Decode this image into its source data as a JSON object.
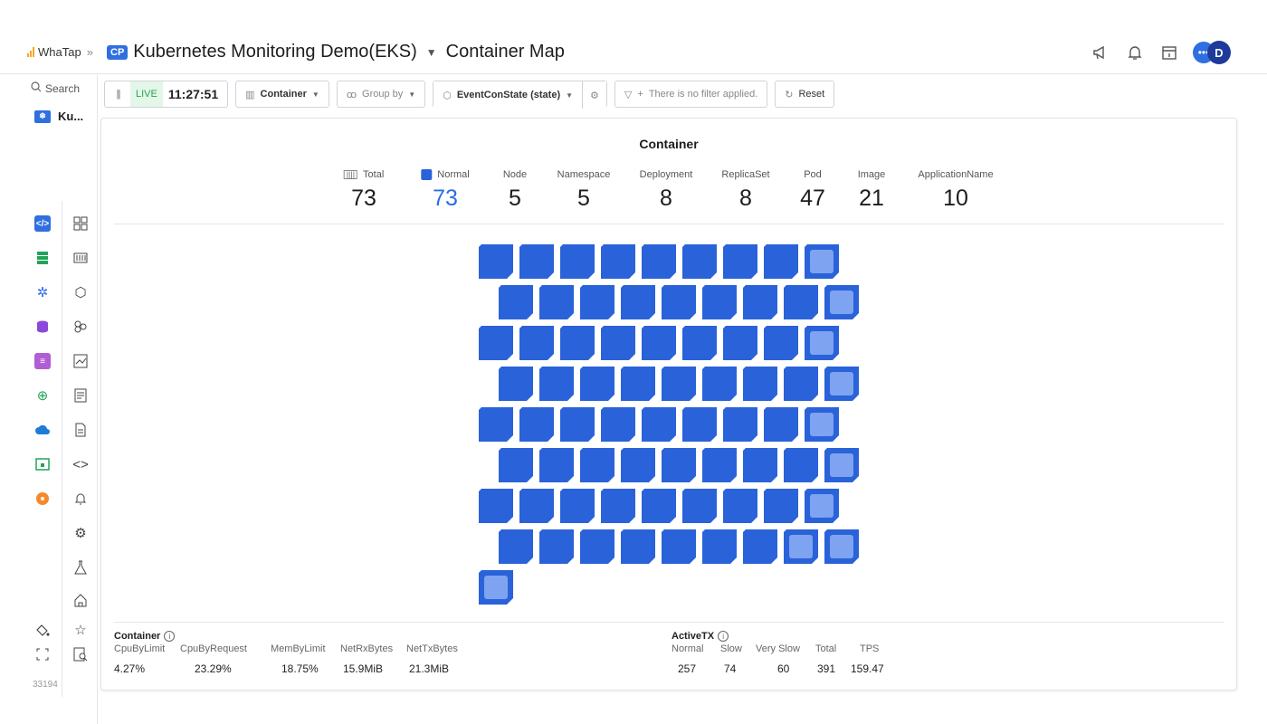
{
  "brand": {
    "name": "WhaTap",
    "chevron": "»"
  },
  "header": {
    "badge": "CP",
    "project": "Kubernetes Monitoring Demo(EKS)",
    "page": "Container Map"
  },
  "user": {
    "initial": "D"
  },
  "sidebar": {
    "search_label": "Search",
    "project_short": "Ku...",
    "version": "33194"
  },
  "toolbar": {
    "live_label": "LIVE",
    "time": "11:27:51",
    "container_label": "Container",
    "groupby_label": "Group by",
    "state_label": "EventConState (state)",
    "filter_placeholder": "There is no filter applied.",
    "reset_label": "Reset"
  },
  "panel": {
    "title": "Container",
    "stats": [
      {
        "label": "Total",
        "value": "73"
      },
      {
        "label": "Normal",
        "value": "73"
      },
      {
        "label": "Node",
        "value": "5"
      },
      {
        "label": "Namespace",
        "value": "5"
      },
      {
        "label": "Deployment",
        "value": "8"
      },
      {
        "label": "ReplicaSet",
        "value": "8"
      },
      {
        "label": "Pod",
        "value": "47"
      },
      {
        "label": "Image",
        "value": "21"
      },
      {
        "label": "ApplicationName",
        "value": "10"
      }
    ]
  },
  "container_metrics": {
    "title": "Container",
    "columns": [
      "CpuByLimit",
      "CpuByRequest",
      "MemByLimit",
      "NetRxBytes",
      "NetTxBytes"
    ],
    "values": [
      "4.27%",
      "23.29%",
      "18.75%",
      "15.9MiB",
      "21.3MiB"
    ]
  },
  "activetx": {
    "title": "ActiveTX",
    "columns": [
      "Normal",
      "Slow",
      "Very Slow",
      "Total",
      "TPS"
    ],
    "values": [
      "257",
      "74",
      "60",
      "391",
      "159.47"
    ]
  },
  "map": {
    "container_count": 73,
    "normal_color": "#2a62d9",
    "highlight_color": "#7ea3f0"
  },
  "colors": {
    "accent": "#2f6fe0",
    "live": "#23a550"
  }
}
